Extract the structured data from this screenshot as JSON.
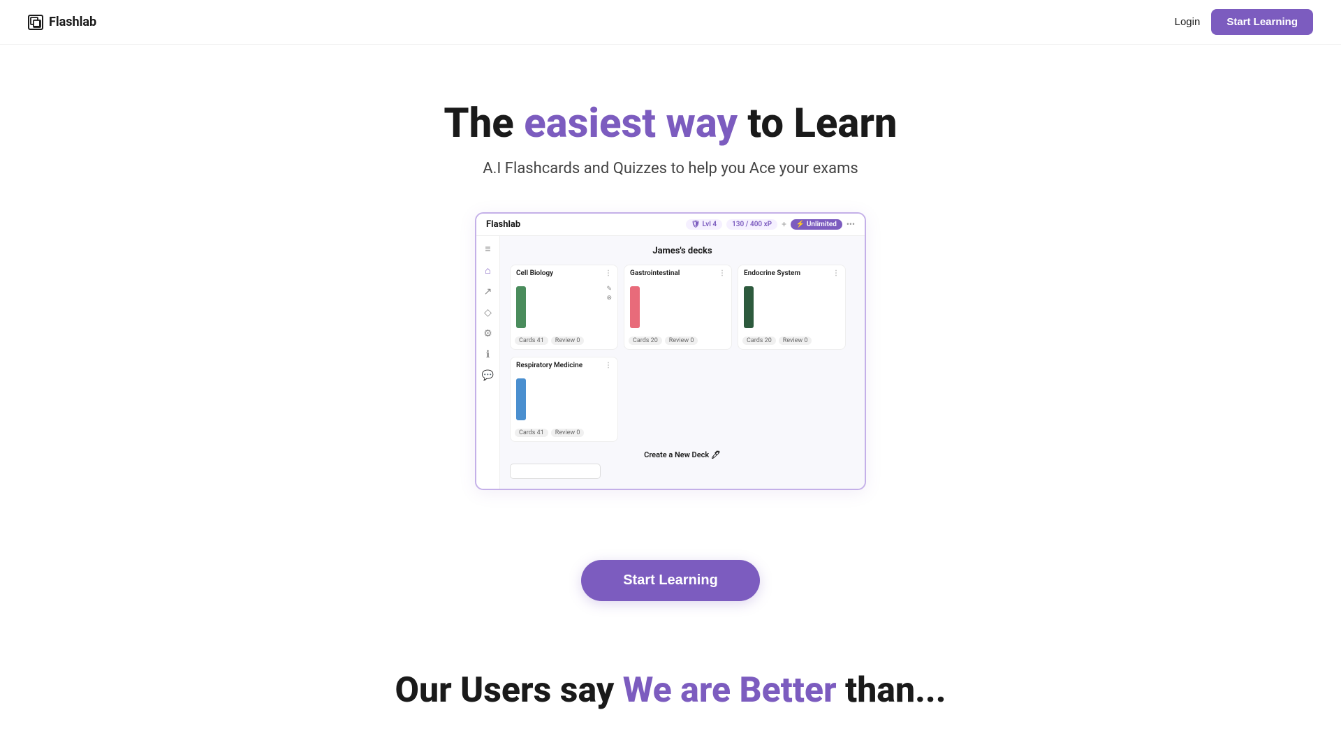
{
  "nav": {
    "logo_text": "Flashlab",
    "login_label": "Login",
    "start_learning_label": "Start Learning"
  },
  "hero": {
    "title_prefix": "The ",
    "title_accent": "easiest way",
    "title_suffix": " to Learn",
    "subtitle": "A.I Flashcards and Quizzes to help you Ace your exams"
  },
  "app_screenshot": {
    "logo": "Flashlab",
    "badge_level": "Lvl 4",
    "badge_xp": "130 / 400 xP",
    "badge_unlimited": "⚡ Unlimited",
    "section_title": "James's decks",
    "decks": [
      {
        "name": "Cell Biology",
        "bar_color": "green",
        "cards": "Cards: 41",
        "review": "Review: 0"
      },
      {
        "name": "Gastrointestinal",
        "bar_color": "pink",
        "cards": "Cards: 20",
        "review": "Review: 0"
      },
      {
        "name": "Endocrine System",
        "bar_color": "darkgreen",
        "cards": "Cards: 20",
        "review": "Review: 0"
      },
      {
        "name": "Respiratory Medicine",
        "bar_color": "blue",
        "cards": "Cards: 41",
        "review": "Review: 0"
      }
    ],
    "create_deck_title": "Create a New Deck 🖊",
    "create_deck_placeholder": ""
  },
  "cta": {
    "label": "Start Learning"
  },
  "bottom": {
    "prefix": "Our Users say ",
    "accent": "We are Better",
    "suffix": " than..."
  }
}
